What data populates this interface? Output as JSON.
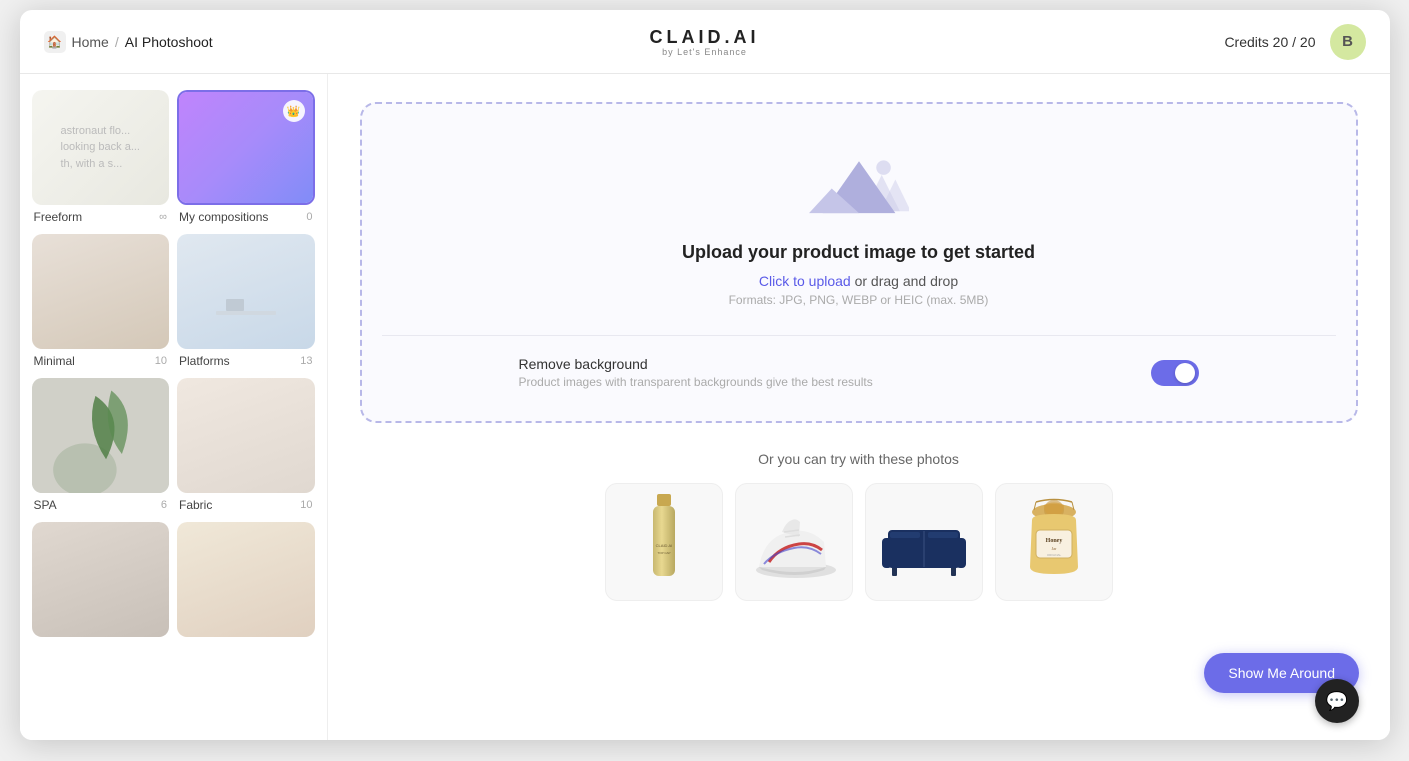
{
  "header": {
    "home_label": "Home",
    "separator": "/",
    "page_title": "AI Photoshoot",
    "logo_text": "CLAID.AI",
    "logo_subtitle": "by Let's Enhance",
    "credits_label": "Credits 20 / 20",
    "avatar_letter": "B"
  },
  "sidebar": {
    "items": [
      {
        "id": "freeform",
        "label": "Freeform",
        "count": "∞",
        "type": "freeform",
        "selected": false
      },
      {
        "id": "my-compositions",
        "label": "My compositions",
        "count": "0",
        "type": "compositions",
        "selected": true
      },
      {
        "id": "minimal",
        "label": "Minimal",
        "count": "10",
        "type": "minimal",
        "selected": false
      },
      {
        "id": "platforms",
        "label": "Platforms",
        "count": "13",
        "type": "platforms",
        "selected": false
      },
      {
        "id": "spa",
        "label": "SPA",
        "count": "6",
        "type": "spa",
        "selected": false
      },
      {
        "id": "fabric",
        "label": "Fabric",
        "count": "10",
        "type": "fabric",
        "selected": false
      },
      {
        "id": "extra1",
        "label": "",
        "count": "",
        "type": "extra1",
        "selected": false
      },
      {
        "id": "extra2",
        "label": "",
        "count": "",
        "type": "extra2",
        "selected": false
      }
    ]
  },
  "upload": {
    "title": "Upload your product image to get started",
    "click_label": "Click to upload",
    "drag_label": " or drag and drop",
    "formats": "Formats: JPG, PNG, WEBP or HEIC (max. 5MB)",
    "remove_bg_label": "Remove background",
    "remove_bg_desc": "Product images with transparent backgrounds give the best results",
    "toggle_on": true
  },
  "samples": {
    "title": "Or you can try with these photos",
    "photos": [
      {
        "id": "bottle",
        "alt": "Bottle product"
      },
      {
        "id": "sneaker",
        "alt": "Sneaker product"
      },
      {
        "id": "sofa",
        "alt": "Sofa product"
      },
      {
        "id": "honey",
        "alt": "Honey jar product"
      }
    ]
  },
  "footer": {
    "show_me_around": "Show Me Around",
    "chat_icon": "💬"
  }
}
